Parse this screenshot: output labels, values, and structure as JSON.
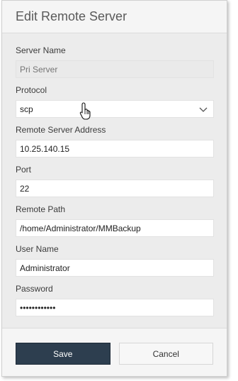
{
  "dialog": {
    "title": "Edit Remote Server"
  },
  "fields": {
    "server_name": {
      "label": "Server Name",
      "placeholder": "Pri Server",
      "value": ""
    },
    "protocol": {
      "label": "Protocol",
      "value": "scp"
    },
    "remote_address": {
      "label": "Remote Server Address",
      "value": "10.25.140.15"
    },
    "port": {
      "label": "Port",
      "value": "22"
    },
    "remote_path": {
      "label": "Remote Path",
      "value": "/home/Administrator/MMBackup"
    },
    "user_name": {
      "label": "User Name",
      "value": "Administrator"
    },
    "password": {
      "label": "Password",
      "value": "••••••••••••"
    }
  },
  "buttons": {
    "save": "Save",
    "cancel": "Cancel"
  },
  "icons": {
    "dropdown": "chevron-down-icon",
    "cursor": "hand-cursor-icon"
  },
  "colors": {
    "primary_button": "#2d3e4f",
    "dialog_bg": "#f5f5f5",
    "body_bg": "#ececec"
  }
}
